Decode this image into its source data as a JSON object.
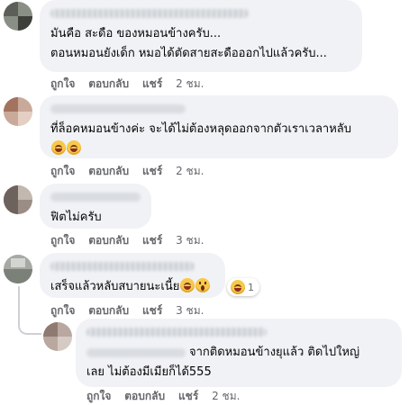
{
  "comments": [
    {
      "lines": [
        "มันคือ สะดือ ของหมอนข้างครับ...",
        "ตอนหมอนยังเด็ก หมอได้ตัดสายสะดือออกไปแล้วครับ..."
      ],
      "actions": {
        "like": "ถูกใจ",
        "reply": "ตอบกลับ",
        "share": "แชร์",
        "time": "2 ชม."
      }
    },
    {
      "lines": [
        "ที่ล็อคหมอนข้างค่ะ จะได้ไม่ต้องหลุดออกจากตัวเราเวลาหลับ"
      ],
      "actions": {
        "like": "ถูกใจ",
        "reply": "ตอบกลับ",
        "share": "แชร์",
        "time": "2 ชม."
      }
    },
    {
      "lines": [
        "ฟิตไม่ครับ"
      ],
      "actions": {
        "like": "ถูกใจ",
        "reply": "ตอบกลับ",
        "share": "แชร์",
        "time": "3 ชม."
      }
    },
    {
      "lines": [
        "เสร็จแล้วหลับสบายนะเนี้ย"
      ],
      "reaction_count": "1",
      "actions": {
        "like": "ถูกใจ",
        "reply": "ตอบกลับ",
        "share": "แชร์",
        "time": "3 ชม."
      }
    },
    {
      "lines": [
        "จากติดหมอนข้างยุแล้ว ติดไปใหญ่",
        "เลย ไม่ต้องมีเมียก็ได้555"
      ],
      "actions": {
        "like": "ถูกใจ",
        "reply": "ตอบกลับ",
        "share": "แชร์",
        "time": "2 ชม."
      }
    }
  ],
  "colors": {
    "bubble": "#f0f2f5",
    "meta_text": "#65676b",
    "text": "#050505"
  },
  "icons": [
    "laughing-emoji-icon",
    "grinning-emoji-icon",
    "surprised-emoji-icon"
  ]
}
